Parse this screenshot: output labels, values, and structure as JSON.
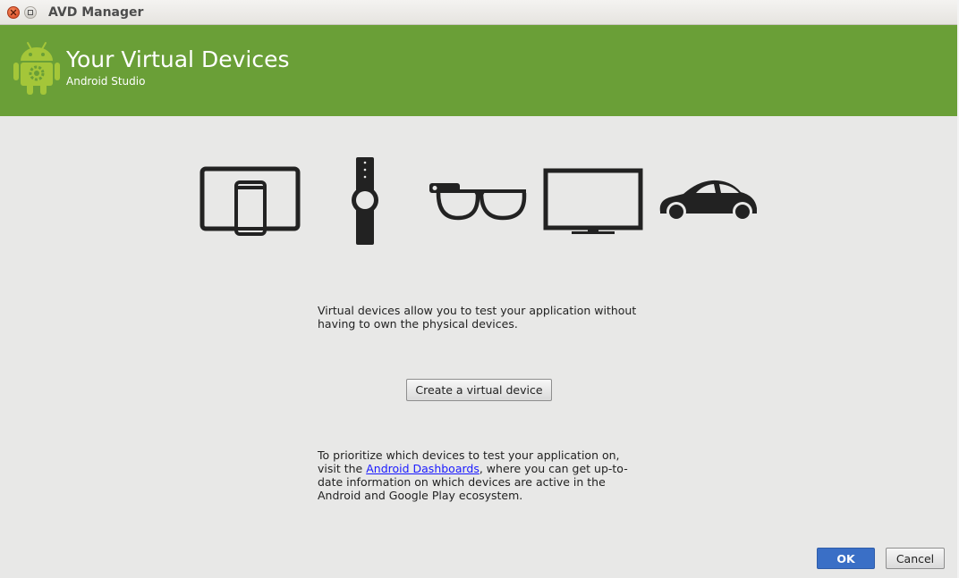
{
  "window": {
    "title": "AVD Manager"
  },
  "header": {
    "title": "Your Virtual Devices",
    "subtitle": "Android Studio"
  },
  "device_icons": [
    "phone-tablet-icon",
    "watch-icon",
    "glass-icon",
    "tv-icon",
    "car-icon"
  ],
  "main": {
    "description": "Virtual devices allow you to test your application without having to own the physical devices.",
    "create_button_label": "Create a virtual device",
    "info_prefix": "To prioritize which devices to test your application on, visit the ",
    "info_link": "Android Dashboards",
    "info_suffix": ", where you can get up-to-date information on which devices are active in the Android and Google Play ecosystem."
  },
  "footer": {
    "ok_label": "OK",
    "cancel_label": "Cancel"
  },
  "colors": {
    "header_green": "#6a9f37",
    "background": "#e8e8e7",
    "ok_blue": "#3a6fc6",
    "icon_dark": "#222222",
    "android_green": "#a4c639"
  }
}
